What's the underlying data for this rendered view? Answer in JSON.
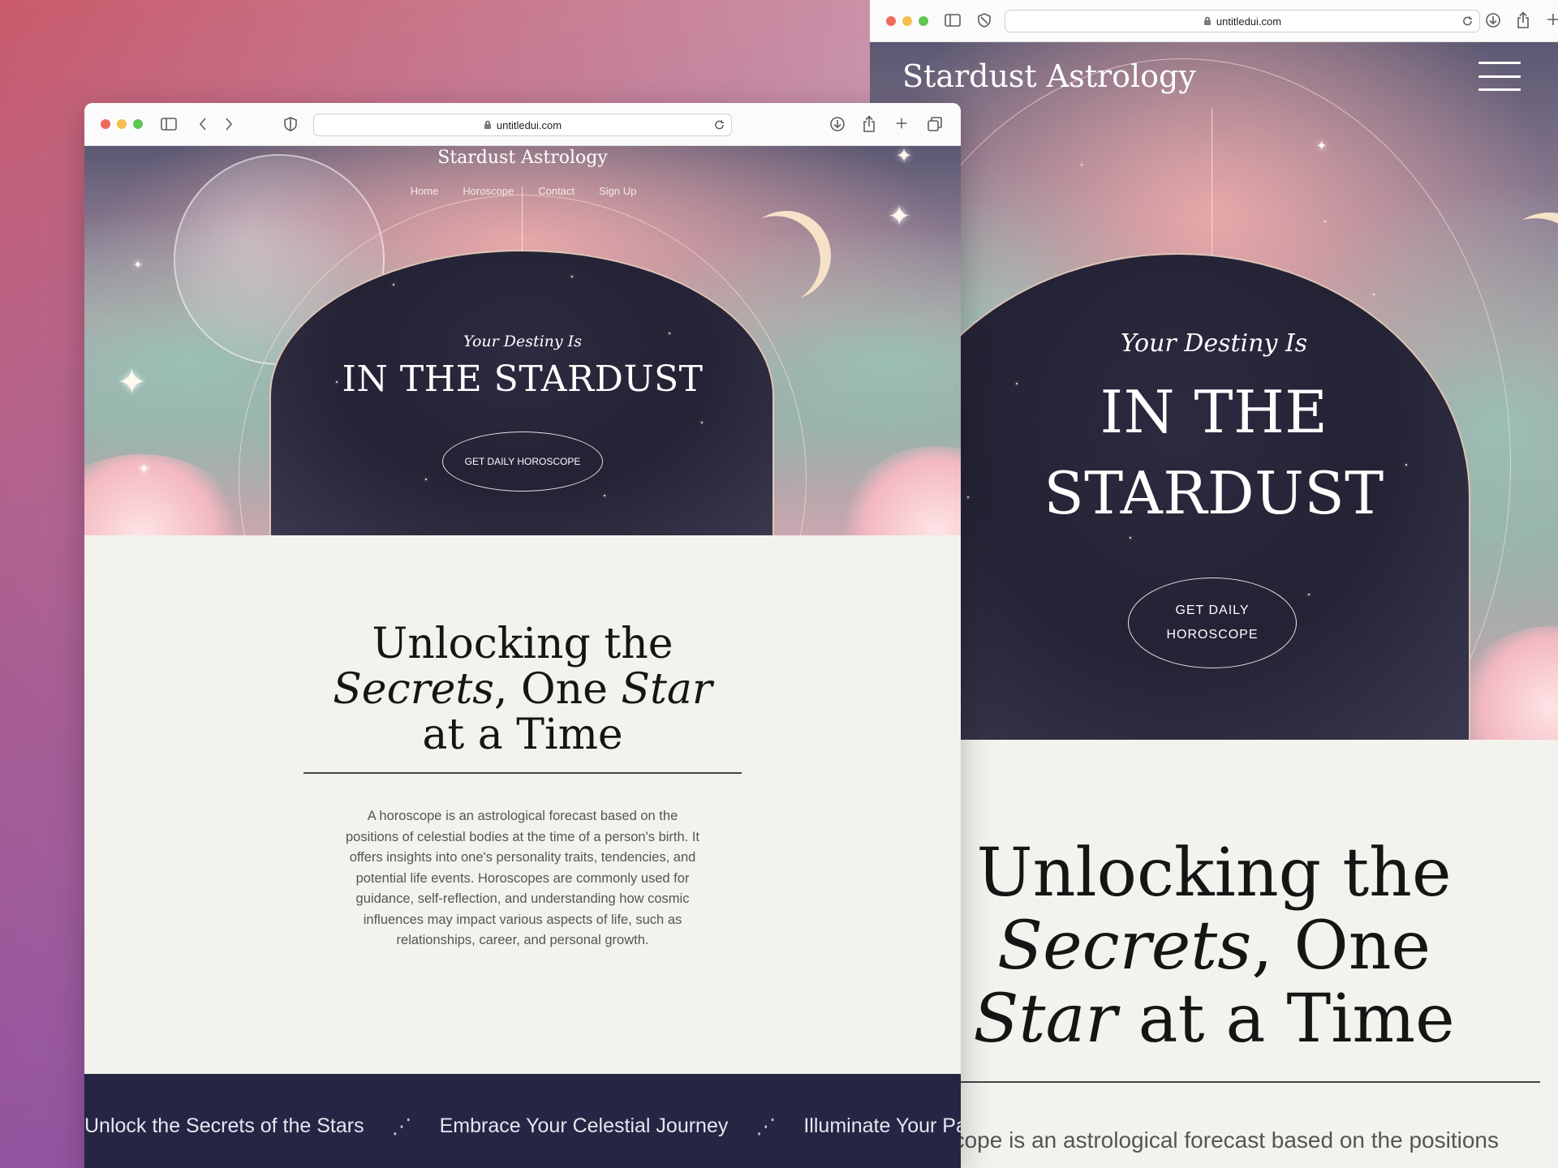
{
  "browser": {
    "url": "untitledui.com"
  },
  "site": {
    "brand": "Stardust Astrology",
    "nav": [
      "Home",
      "Horoscope",
      "Contact",
      "Sign Up"
    ],
    "hero": {
      "kicker": "Your Destiny Is",
      "title": "IN THE STARDUST",
      "title_line1": "IN THE",
      "title_line2": "STARDUST",
      "cta": "GET DAILY HOROSCOPE",
      "cta_line1": "GET DAILY",
      "cta_line2": "HOROSCOPE"
    },
    "intro": {
      "heading_plain_1": "Unlocking the",
      "heading_italic_1": "Secrets",
      "heading_plain_2": ", One",
      "heading_italic_2": "Star",
      "heading_plain_3": "at a Time",
      "paragraph": "A horoscope is an astrological forecast based on the positions of celestial bodies at the time of a person's birth. It offers insights into one's personality traits, tendencies, and potential life events. Horoscopes are commonly used for guidance, self-reflection, and understanding how cosmic influences may impact various aspects of life, such as relationships, career, and personal growth.",
      "paragraph_mobile_visible": "oscope is an astrological forecast based on the positions"
    },
    "marquee": [
      "Unlock the Secrets of the Stars",
      "Embrace Your Celestial Journey",
      "Illuminate Your Pa"
    ]
  },
  "icons": {
    "sidebar": "sidebar-icon",
    "back": "chevron-left-icon",
    "forward": "chevron-right-icon",
    "shield": "shield-icon",
    "lock": "lock-icon",
    "reload": "reload-icon",
    "download": "download-icon",
    "share": "share-icon",
    "new_tab": "plus-icon",
    "tabs": "tabs-overview-icon",
    "menu": "hamburger-menu-icon",
    "separator": "sparkle-icon"
  },
  "colors": {
    "page_bg": "#f3f2ed",
    "band_bg": "#252544",
    "portal": "#242234"
  }
}
